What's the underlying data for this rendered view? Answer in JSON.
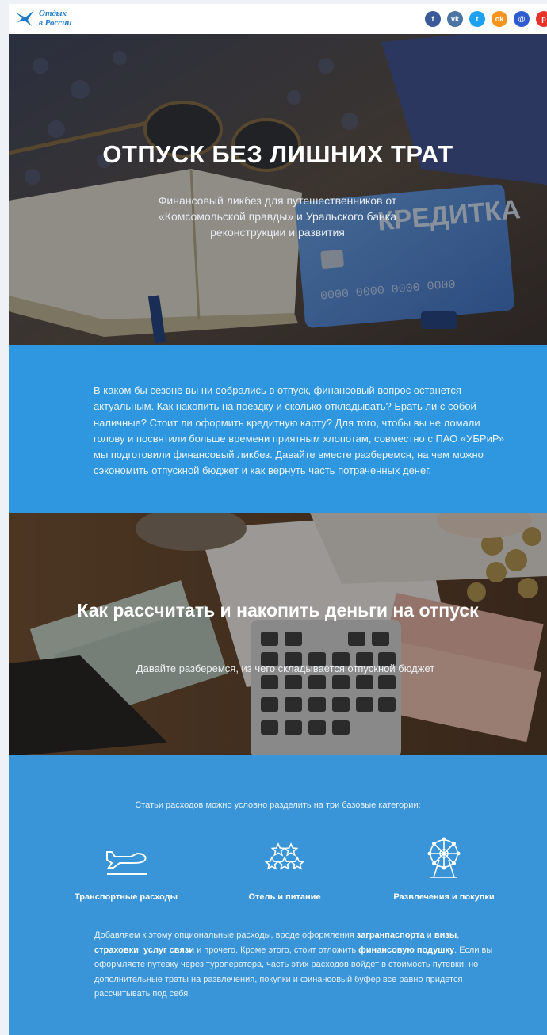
{
  "header": {
    "logo_line1": "Отдых",
    "logo_line2": "в России",
    "socials": [
      {
        "icon": "facebook-icon",
        "glyph": "f",
        "color": "#3b5998"
      },
      {
        "icon": "vk-icon",
        "glyph": "vk",
        "color": "#4c75a3"
      },
      {
        "icon": "twitter-icon",
        "glyph": "t",
        "color": "#1da1f2"
      },
      {
        "icon": "odnoklassniki-icon",
        "glyph": "ok",
        "color": "#f7931e"
      },
      {
        "icon": "mailru-icon",
        "glyph": "@",
        "color": "#2f5bd1"
      },
      {
        "icon": "pocket-icon",
        "glyph": "p",
        "color": "#e5332a"
      }
    ]
  },
  "hero": {
    "title": "ОТПУСК БЕЗ ЛИШНИХ ТРАТ",
    "subtitle": "Финансовый ликбез для путешественников от «Комсомольской правды» и Уральского банка реконструкции и развития",
    "card_text": "КРЕДИТКА",
    "card_number": "0000 0000 0000 0000"
  },
  "intro": {
    "text": "В каком бы сезоне вы ни собрались в отпуск, финансовый вопрос останется актуальным. Как накопить на поездку и сколько откладывать? Брать ли с собой наличные? Стоит ли оформить кредитную карту? Для того, чтобы вы не ломали голову и посвятили больше времени приятным хлопотам, совместно с ПАО «УБРиР» мы подготовили финансовый ликбез. Давайте вместе разберемся, на чем можно сэкономить отпускной бюджет и как вернуть часть потраченных денег."
  },
  "money": {
    "title": "Как рассчитать и накопить деньги на отпуск",
    "subtitle": "Давайте разберемся, из чего складывается отпускной бюджет"
  },
  "categories": {
    "lead": "Статьи расходов можно условно разделить на три базовые категории:",
    "items": [
      {
        "label": "Транспортные расходы",
        "icon": "airplane-icon"
      },
      {
        "label": "Отель и питание",
        "icon": "stars-icon"
      },
      {
        "label": "Развлечения и покупки",
        "icon": "ferris-wheel-icon"
      }
    ],
    "text": {
      "t1": "Добавляем к этому опциональные расходы, вроде оформления ",
      "b1": "загранпаспорта",
      "t2": " и ",
      "b2": "визы",
      "t3": ", ",
      "b3": "страховки",
      "t4": ", ",
      "b4": "услуг связи",
      "t5": " и прочего. Кроме этого, стоит отложить ",
      "b5": "финансовую подушку",
      "t6": ". Если вы оформляете путевку через туроператора, часть этих расходов войдет в стоимость путевки, но дополнительные траты на развлечения, покупки и финансовый буфер все равно придется рассчитывать под себя."
    }
  }
}
